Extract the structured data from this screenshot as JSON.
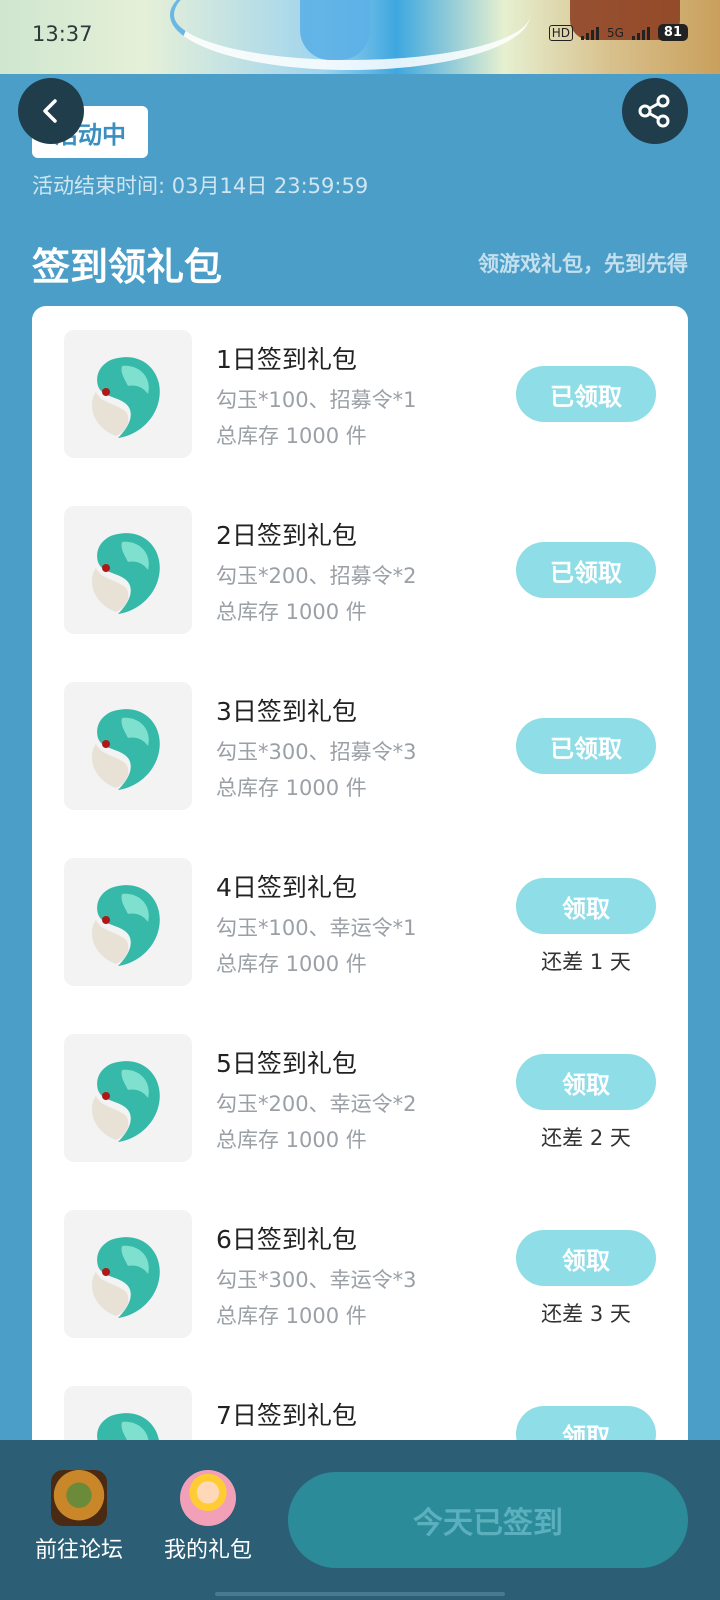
{
  "status_bar": {
    "time": "13:37",
    "network": "HD",
    "network2": "5G",
    "battery": "81"
  },
  "header": {
    "status_chip": "活动中",
    "end_time": "活动结束时间: 03月14日 23:59:59",
    "section_title": "签到领礼包",
    "section_subtitle": "领游戏礼包，先到先得"
  },
  "gifts": [
    {
      "name": "1日签到礼包",
      "items": "勾玉*100、招募令*1",
      "stock": "总库存 1000 件",
      "button": "已领取",
      "days_left": ""
    },
    {
      "name": "2日签到礼包",
      "items": "勾玉*200、招募令*2",
      "stock": "总库存 1000 件",
      "button": "已领取",
      "days_left": ""
    },
    {
      "name": "3日签到礼包",
      "items": "勾玉*300、招募令*3",
      "stock": "总库存 1000 件",
      "button": "已领取",
      "days_left": ""
    },
    {
      "name": "4日签到礼包",
      "items": "勾玉*100、幸运令*1",
      "stock": "总库存 1000 件",
      "button": "领取",
      "days_left": "还差 1 天"
    },
    {
      "name": "5日签到礼包",
      "items": "勾玉*200、幸运令*2",
      "stock": "总库存 1000 件",
      "button": "领取",
      "days_left": "还差 2 天"
    },
    {
      "name": "6日签到礼包",
      "items": "勾玉*300、幸运令*3",
      "stock": "总库存 1000 件",
      "button": "领取",
      "days_left": "还差 3 天"
    },
    {
      "name": "7日签到礼包",
      "items": "",
      "stock": "",
      "button": "领取",
      "days_left": ""
    }
  ],
  "bottom": {
    "forum_label": "前往论坛",
    "mygift_label": "我的礼包",
    "checkin_label": "今天已签到"
  },
  "colors": {
    "page_bg": "#4a9ec8",
    "button_teal": "#8fdde6",
    "bottom_bar": "#2c5e75",
    "checkin_btn": "#2b8b99"
  },
  "icons": [
    "back-arrow-icon",
    "share-icon",
    "magatama-icon",
    "forum-game-icon",
    "my-gift-avatar-icon"
  ]
}
